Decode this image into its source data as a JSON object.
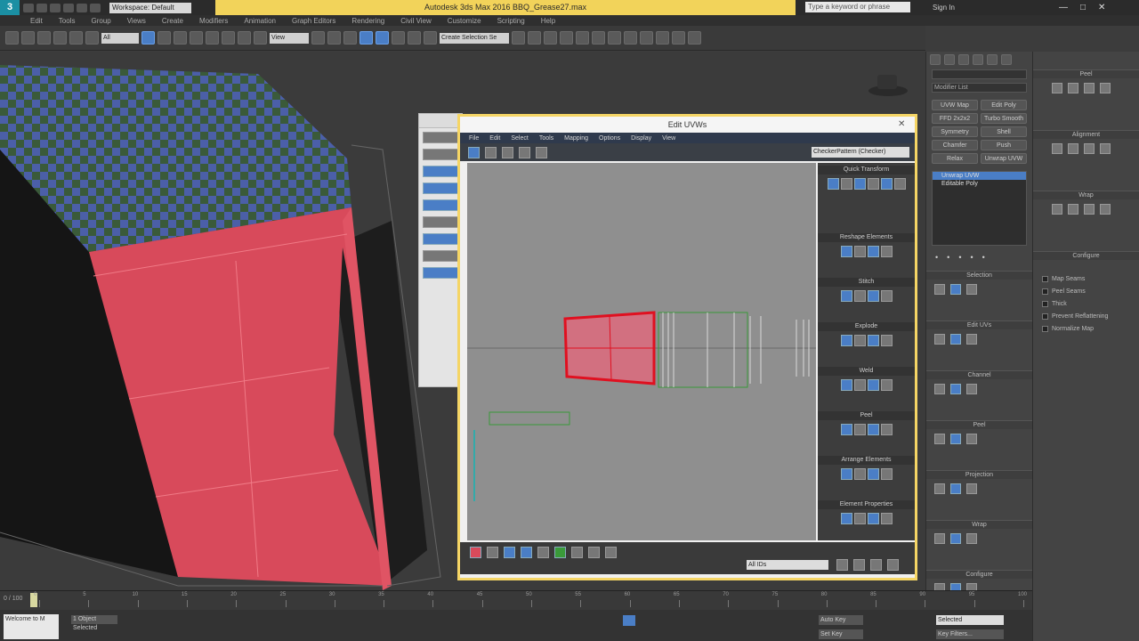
{
  "window": {
    "title": "Autodesk 3ds Max 2016     BBQ_Grease27.max",
    "workspace": "Workspace: Default",
    "search_placeholder": "Type a keyword or phrase",
    "sign_in": "Sign In"
  },
  "menubar": [
    "Edit",
    "Tools",
    "Group",
    "Views",
    "Create",
    "Modifiers",
    "Animation",
    "Graph Editors",
    "Rendering",
    "Civil View",
    "Customize",
    "Scripting",
    "Help"
  ],
  "toolbar": {
    "selection_filter": "All",
    "ref_coord": "View",
    "named_sel": "Create Selection Se"
  },
  "uv_editor": {
    "title": "Edit UVWs",
    "menu": [
      "File",
      "Edit",
      "Select",
      "Tools",
      "Mapping",
      "Options",
      "Display",
      "View"
    ],
    "texture_dropdown": "CheckerPattern (Checker)",
    "side_sections": [
      "Quick Transform",
      "Reshape Elements",
      "Stitch",
      "Explode",
      "Weld",
      "Peel",
      "Arrange Elements",
      "Element Properties"
    ],
    "bottom_field": "All IDs",
    "float_label": "All IDs"
  },
  "command_panel": {
    "modifier_list": "Modifier List",
    "stack_items": [
      "Unwrap UVW",
      "Editable Poly"
    ],
    "buttons": [
      "UVW Map",
      "Edit Poly",
      "FFD 2x2x2",
      "Turbo Smooth",
      "Symmetry",
      "Shell",
      "Chamfer",
      "Push",
      "Relax",
      "Unwrap UVW"
    ],
    "rollups": [
      "Selection",
      "Edit UVs",
      "Channel",
      "Peel",
      "Projection",
      "Wrap",
      "Configure"
    ]
  },
  "right_panel": {
    "rollups": [
      "Peel",
      "Alignment",
      "Wrap",
      "Configure"
    ],
    "options": [
      "Map Seams",
      "Peel Seams",
      "Thick",
      "Prevent Reflattening",
      "Normalize Map"
    ]
  },
  "timeline": {
    "frame_label": "0 / 100",
    "ticks": [
      0,
      5,
      10,
      15,
      20,
      25,
      30,
      35,
      40,
      45,
      50,
      55,
      60,
      65,
      70,
      75,
      80,
      85,
      90,
      95,
      100
    ]
  },
  "status": {
    "prompt": "Welcome to M",
    "selected": "1 Object Selected",
    "auto_key": "Auto Key",
    "set_key": "Set Key",
    "key_mode": "Selected",
    "key_filters": "Key Filters..."
  }
}
